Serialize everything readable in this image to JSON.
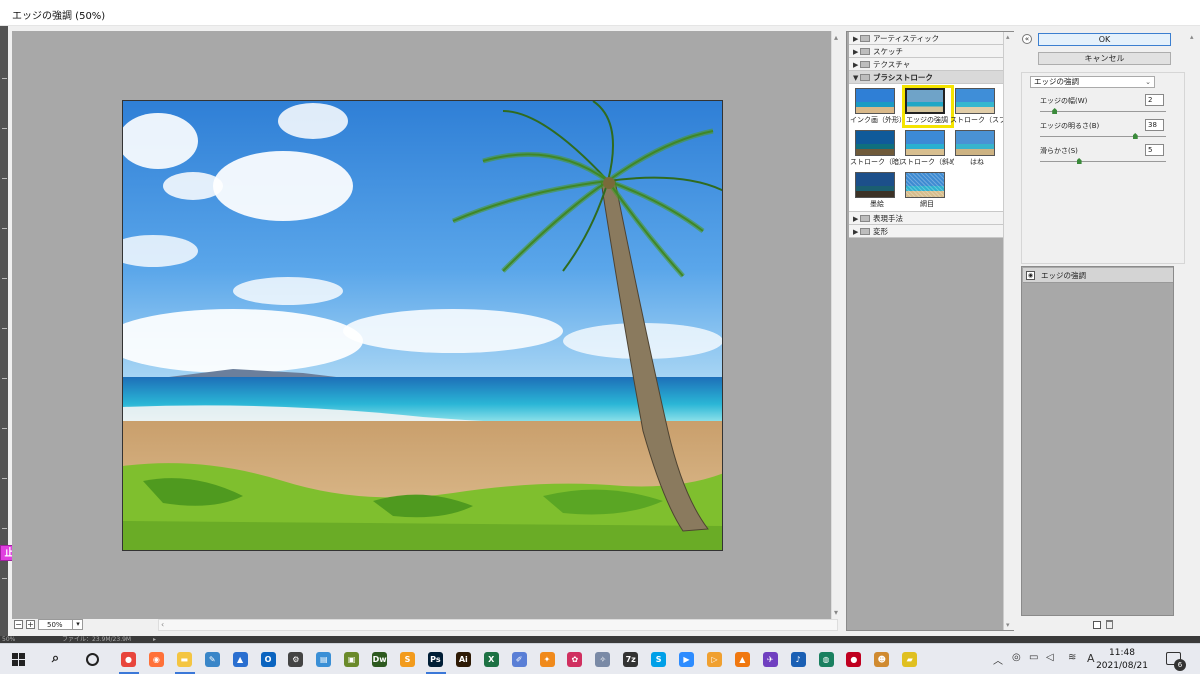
{
  "window": {
    "title": "エッジの強調 (50%)"
  },
  "badge": {
    "label": "止"
  },
  "preview": {
    "zoom": "50%"
  },
  "gallery": {
    "categories_top": [
      "アーティスティック",
      "スケッチ",
      "テクスチャ"
    ],
    "open_category": "ブラシストローク",
    "thumbnails": [
      "インク画（外形）",
      "エッジの強調",
      "ストローク（スプレー）",
      "ストローク（暗）",
      "ストローク（斜め）",
      "はね",
      "墨絵",
      "網目"
    ],
    "selected": "エッジの強調",
    "categories_bottom": [
      "表現手法",
      "変形"
    ]
  },
  "buttons": {
    "ok": "OK",
    "cancel": "キャンセル"
  },
  "settings": {
    "filter": "エッジの強調",
    "params": [
      {
        "label": "エッジの幅(W)",
        "value": "2",
        "level": 0.1
      },
      {
        "label": "エッジの明るさ(B)",
        "value": "38",
        "level": 0.76
      },
      {
        "label": "滑らかさ(S)",
        "value": "5",
        "level": 0.3
      }
    ]
  },
  "layers": {
    "items": [
      "エッジの強調"
    ]
  },
  "status": {
    "zoom": "50%",
    "info": "ファイル：23.9M/23.9M"
  },
  "taskbar": {
    "apps": [
      "Chrome",
      "Firefox",
      "File Explorer",
      "Pen Tool",
      "Photos",
      "Outlook",
      "Settings",
      "Control Panel",
      "Game",
      "Dw",
      "Sublime",
      "Ps",
      "Ai",
      "Excel",
      "Tool",
      "Butterfly",
      "Feather",
      "Wand",
      "7z",
      "Skype",
      "Zoom",
      "Player",
      "VLC",
      "Bird",
      "Music",
      "Sphere",
      "Record",
      "Cat",
      "Sticky"
    ],
    "time": "11:48",
    "date": "2021/08/21",
    "ime": "A",
    "notifications": "6"
  }
}
